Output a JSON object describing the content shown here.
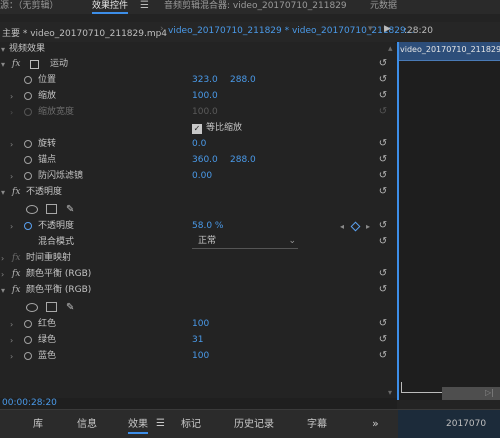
{
  "top_tabs": [
    {
      "label": "源：（无剪辑）",
      "active": false
    },
    {
      "label": "效果控件",
      "active": true
    },
    {
      "label": "音频剪辑混合器: video_20170710_211829",
      "active": false
    },
    {
      "label": "元数据",
      "active": false
    }
  ],
  "top_menu_icon": "hamburger-icon",
  "second_bar": {
    "master_label": "主要 * video_20170710_211829.mp4",
    "clip_label": "video_20170710_211829 * video_20170710_211829...",
    "play_icon": "play-icon",
    "time_marker": ":28:20",
    "clip_block_label": "video_20170710_211829.mp"
  },
  "section_title": "视频效果",
  "motion": {
    "label": "运动",
    "position": {
      "label": "位置",
      "x": "323.0",
      "y": "288.0"
    },
    "scale": {
      "label": "缩放",
      "value": "100.0"
    },
    "scale_width": {
      "label": "缩放宽度",
      "value": "100.0"
    },
    "uniform_scale": {
      "label": "等比缩放",
      "checked": true
    },
    "rotation": {
      "label": "旋转",
      "value": "0.0"
    },
    "anchor": {
      "label": "锚点",
      "x": "360.0",
      "y": "288.0"
    },
    "anti_flicker": {
      "label": "防闪烁滤镜",
      "value": "0.00"
    }
  },
  "opacity": {
    "label": "不透明度",
    "value_label": "不透明度",
    "value": "58.0 %",
    "blend_label": "混合模式",
    "blend_value": "正常"
  },
  "time_remap": {
    "label": "时间重映射"
  },
  "color_balance_1": {
    "label": "颜色平衡 (RGB)"
  },
  "color_balance_2": {
    "label": "颜色平衡 (RGB)",
    "red": {
      "label": "红色",
      "value": "100"
    },
    "green": {
      "label": "绿色",
      "value": "31"
    },
    "blue": {
      "label": "蓝色",
      "value": "100"
    }
  },
  "timecode": "00:00:28:20",
  "bottom_tabs": [
    {
      "label": "库"
    },
    {
      "label": "信息"
    },
    {
      "label": "效果"
    },
    {
      "label": "标记"
    },
    {
      "label": "历史记录"
    },
    {
      "label": "字幕"
    }
  ],
  "bottom_right_label": "2017070",
  "colors": {
    "accent": "#3d8ee8",
    "value_blue": "#4a9ae9",
    "panel_bg": "#232323"
  }
}
